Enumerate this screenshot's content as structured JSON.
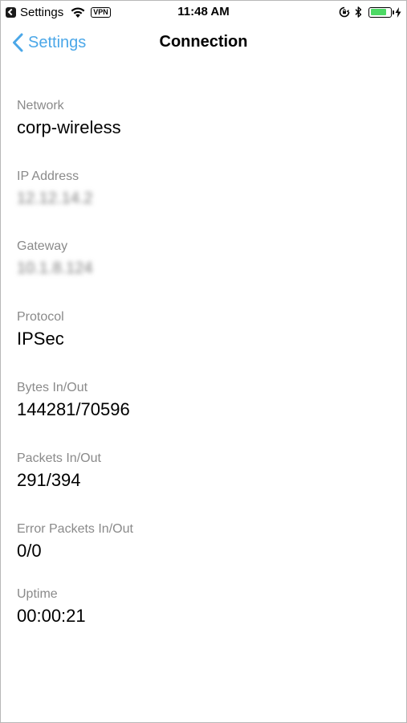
{
  "status_bar": {
    "back_app": "Settings",
    "vpn": "VPN",
    "time": "11:48 AM",
    "battery_level": 0.85,
    "battery_color": "#4cd964",
    "icons": [
      "back-app-icon",
      "wifi-icon",
      "lock-rotation-icon",
      "bluetooth-icon",
      "battery-icon",
      "charging-icon"
    ]
  },
  "nav": {
    "back_label": "Settings",
    "title": "Connection",
    "accent_color": "#4ba7e8"
  },
  "details": [
    {
      "label": "Network",
      "value": "corp-wireless",
      "blurred": false
    },
    {
      "label": "IP Address",
      "value": "12.12.14.2",
      "blurred": true
    },
    {
      "label": "Gateway",
      "value": "10.1.8.124",
      "blurred": true
    },
    {
      "label": "Protocol",
      "value": "IPSec",
      "blurred": false
    },
    {
      "label": "Bytes In/Out",
      "value": "144281/70596",
      "blurred": false
    },
    {
      "label": "Packets In/Out",
      "value": "291/394",
      "blurred": false
    },
    {
      "label": "Error Packets In/Out",
      "value": "0/0",
      "blurred": false
    },
    {
      "label": "Uptime",
      "value": "00:00:21",
      "blurred": false
    }
  ]
}
